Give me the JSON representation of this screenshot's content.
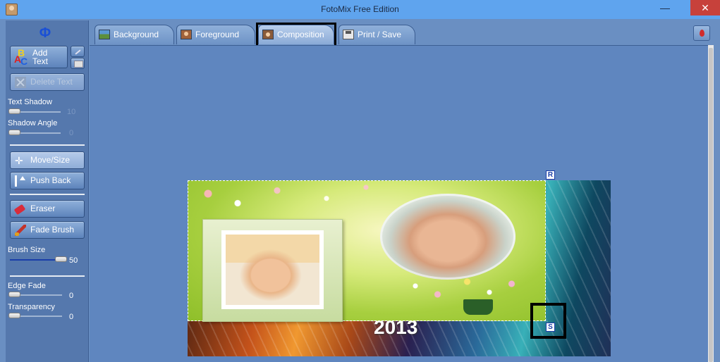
{
  "window": {
    "title": "FotoMix Free Edition",
    "minimize_glyph": "—",
    "close_glyph": "✕",
    "app_icon": "portrait-icon"
  },
  "tabs": [
    {
      "label": "Background",
      "icon": "landscape-icon",
      "active": false
    },
    {
      "label": "Foreground",
      "icon": "portrait-icon",
      "active": false
    },
    {
      "label": "Composition",
      "icon": "composition-icon",
      "active": true
    },
    {
      "label": "Print / Save",
      "icon": "floppy-disk-icon",
      "active": false
    }
  ],
  "help_button": {
    "icon": "help-drop-icon"
  },
  "left_panel": {
    "logo_glyph": "Φ",
    "add_text": {
      "label_line1": "Add",
      "label_line2": "Text",
      "icon": "abc-icon"
    },
    "edit_text_icon": "pen-icon",
    "font_icon": "font-icon",
    "delete_text": {
      "label": "Delete Text",
      "enabled": false
    },
    "text_shadow": {
      "label": "Text Shadow",
      "value": "10",
      "enabled": false
    },
    "shadow_angle": {
      "label": "Shadow Angle",
      "value": "0",
      "enabled": false
    },
    "move_size": {
      "label": "Move/Size",
      "selected": true
    },
    "push_back": {
      "label": "Push Back"
    },
    "eraser": {
      "label": "Eraser"
    },
    "fade_brush": {
      "label": "Fade Brush"
    },
    "brush_size": {
      "label": "Brush Size",
      "value": "50"
    },
    "edge_fade": {
      "label": "Edge Fade",
      "value": "0"
    },
    "transparency": {
      "label": "Transparency",
      "value": "0"
    }
  },
  "canvas": {
    "year_text": "2013",
    "handle_rotate": "R",
    "handle_scale": "S"
  },
  "colors": {
    "titlebar": "#5fa4ee",
    "close": "#c7413b",
    "panel": "#5578ad",
    "workspace": "#5f86bf",
    "accent": "#1a3ea8"
  }
}
